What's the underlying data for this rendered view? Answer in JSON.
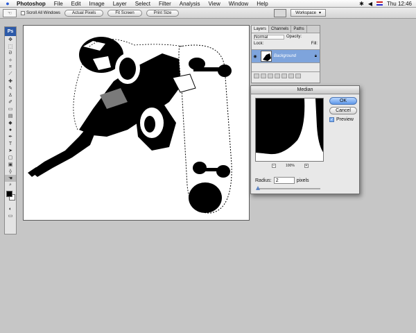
{
  "menubar": {
    "app": "Photoshop",
    "items": [
      "File",
      "Edit",
      "Image",
      "Layer",
      "Select",
      "Filter",
      "Analysis",
      "View",
      "Window",
      "Help"
    ],
    "clock": "Thu 12:46"
  },
  "options": {
    "scroll_all_windows": "Scroll All Windows",
    "actual_pixels": "Actual Pixels",
    "fit_screen": "Fit Screen",
    "print_size": "Print Size",
    "workspace": "Workspace"
  },
  "toolbox": {
    "logo": "Ps",
    "tools": [
      "move-icon",
      "marquee-icon",
      "lasso-icon",
      "magic-wand-icon",
      "crop-icon",
      "slice-icon",
      "healing-icon",
      "brush-icon",
      "clone-stamp-icon",
      "history-brush-icon",
      "eraser-icon",
      "gradient-icon",
      "blur-icon",
      "dodge-icon",
      "pen-icon",
      "type-icon",
      "path-select-icon",
      "shape-icon",
      "notes-icon",
      "eyedropper-icon",
      "hand-icon",
      "zoom-icon"
    ],
    "foreground_color": "#000000",
    "background_color": "#ffffff"
  },
  "layers": {
    "tabs": [
      "Layers",
      "Channels",
      "Paths"
    ],
    "blend_mode": "Normal",
    "opacity_label": "Opacity:",
    "lock_label": "Lock:",
    "fill_label": "Fill:",
    "layer_name": "Background"
  },
  "median": {
    "title": "Median",
    "ok": "OK",
    "cancel": "Cancel",
    "preview_label": "Preview",
    "zoom": "100%",
    "radius_label": "Radius:",
    "radius_value": "2",
    "radius_unit": "pixels",
    "radius_fraction": 0.02
  },
  "colors": {
    "accent": "#5f98e8",
    "layer_selected": "#7ea4dc"
  }
}
